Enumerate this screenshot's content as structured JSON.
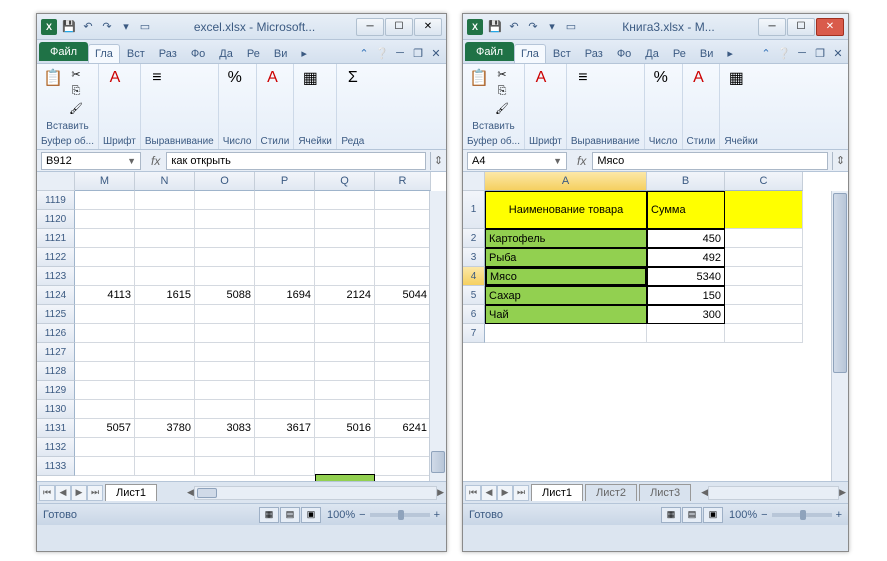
{
  "window1": {
    "title": "excel.xlsx - Microsoft...",
    "tabs": {
      "file": "Файл",
      "home": "Гла",
      "insert": "Вст",
      "layout": "Раз",
      "formulas": "Фо",
      "data": "Да",
      "review": "Ре",
      "view": "Ви"
    },
    "ribbon": {
      "paste": "Вставить",
      "clipboard": "Буфер об...",
      "font": "Шрифт",
      "align": "Выравнивание",
      "number": "Число",
      "styles": "Стили",
      "cells": "Ячейки",
      "editing": "Реда"
    },
    "nameBox": "B912",
    "fx": "как открыть",
    "cols": [
      "M",
      "N",
      "O",
      "P",
      "Q",
      "R"
    ],
    "rows": [
      "1119",
      "1120",
      "1121",
      "1122",
      "1123",
      "1124",
      "1125",
      "1126",
      "1127",
      "1128",
      "1129",
      "1130",
      "1131",
      "1132",
      "1133"
    ],
    "data1124": [
      "4113",
      "1615",
      "5088",
      "1694",
      "2124",
      "5044"
    ],
    "data1131": [
      "5057",
      "3780",
      "3083",
      "3617",
      "5016",
      "6241"
    ],
    "sheet": "Лист1",
    "status": "Готово",
    "zoom": "100%"
  },
  "window2": {
    "title": "Книга3.xlsx - M...",
    "tabs": {
      "file": "Файл",
      "home": "Гла",
      "insert": "Вст",
      "layout": "Раз",
      "formulas": "Фо",
      "data": "Да",
      "review": "Ре",
      "view": "Ви"
    },
    "ribbon": {
      "paste": "Вставить",
      "clipboard": "Буфер об...",
      "font": "Шрифт",
      "align": "Выравнивание",
      "number": "Число",
      "styles": "Стили",
      "cells": "Ячейки"
    },
    "nameBox": "A4",
    "fx": "Мясо",
    "cols": [
      "A",
      "B",
      "C"
    ],
    "rows": [
      "1",
      "2",
      "3",
      "4",
      "5",
      "6",
      "7"
    ],
    "header": {
      "a": "Наименование товара",
      "b": "Сумма"
    },
    "items": [
      {
        "name": "Картофель",
        "sum": "450"
      },
      {
        "name": "Рыба",
        "sum": "492"
      },
      {
        "name": "Мясо",
        "sum": "5340"
      },
      {
        "name": "Сахар",
        "sum": "150"
      },
      {
        "name": "Чай",
        "sum": "300"
      }
    ],
    "sheets": [
      "Лист1",
      "Лист2",
      "Лист3"
    ],
    "status": "Готово",
    "zoom": "100%"
  }
}
